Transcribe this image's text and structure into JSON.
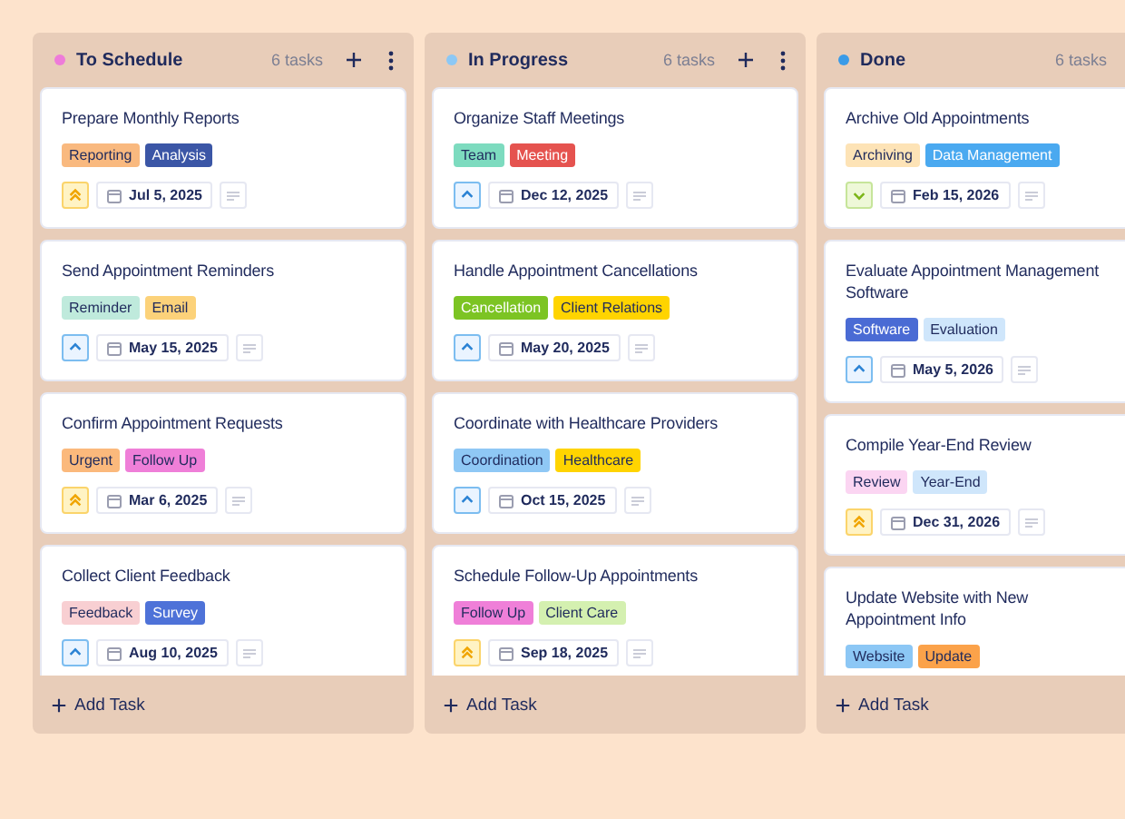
{
  "columns": [
    {
      "title": "To Schedule",
      "color": "#ee7bd9",
      "count": "6 tasks",
      "header_actions": true,
      "add_label": "Add Task",
      "cards": [
        {
          "title": "Prepare Monthly Reports",
          "tags": [
            {
              "label": "Reporting",
              "color": "#f9b97f"
            },
            {
              "label": "Analysis",
              "color": "#3b56a6"
            }
          ],
          "kind": "high",
          "date": "Jul 5, 2025"
        },
        {
          "title": "Send Appointment Reminders",
          "tags": [
            {
              "label": "Reminder",
              "color": "#bfeadc"
            },
            {
              "label": "Email",
              "color": "#fcd27a"
            }
          ],
          "kind": "medium",
          "date": "May 15, 2025"
        },
        {
          "title": "Confirm Appointment Requests",
          "tags": [
            {
              "label": "Urgent",
              "color": "#fbb97c"
            },
            {
              "label": "Follow Up",
              "color": "#ef7fd8"
            }
          ],
          "kind": "high",
          "date": "Mar 6, 2025"
        },
        {
          "title": "Collect Client Feedback",
          "tags": [
            {
              "label": "Feedback",
              "color": "#f8cfd2"
            },
            {
              "label": "Survey",
              "color": "#4e72d8"
            }
          ],
          "kind": "medium",
          "date": "Aug 10, 2025"
        }
      ]
    },
    {
      "title": "In Progress",
      "color": "#8cc8f5",
      "count": "6 tasks",
      "header_actions": true,
      "add_label": "Add Task",
      "cards": [
        {
          "title": "Organize Staff Meetings",
          "tags": [
            {
              "label": "Team",
              "color": "#7ddbbf"
            },
            {
              "label": "Meeting",
              "color": "#e5534f"
            }
          ],
          "kind": "medium",
          "date": "Dec 12, 2025"
        },
        {
          "title": "Handle Appointment Cancellations",
          "tags": [
            {
              "label": "Cancellation",
              "color": "#7cc423"
            },
            {
              "label": "Client Relations",
              "color": "#ffd400"
            }
          ],
          "kind": "medium",
          "date": "May 20, 2025"
        },
        {
          "title": "Coordinate with Healthcare Providers",
          "tags": [
            {
              "label": "Coordination",
              "color": "#8fc8f5"
            },
            {
              "label": "Healthcare",
              "color": "#ffd400"
            }
          ],
          "kind": "medium",
          "date": "Oct 15, 2025"
        },
        {
          "title": "Schedule Follow-Up Appointments",
          "tags": [
            {
              "label": "Follow Up",
              "color": "#ef7fd8"
            },
            {
              "label": "Client Care",
              "color": "#d4f0b0"
            }
          ],
          "kind": "high",
          "date": "Sep 18, 2025"
        }
      ]
    },
    {
      "title": "Done",
      "color": "#3a9be8",
      "count": "6 tasks",
      "header_actions": false,
      "add_label": "Add Task",
      "cards": [
        {
          "title": "Archive Old Appointments",
          "tags": [
            {
              "label": "Archiving",
              "color": "#fde3b6"
            },
            {
              "label": "Data Management",
              "color": "#4aa9f0"
            }
          ],
          "kind": "low",
          "date": "Feb 15, 2026"
        },
        {
          "title": "Evaluate Appointment Management Software",
          "tags": [
            {
              "label": "Software",
              "color": "#4a6bd4"
            },
            {
              "label": "Evaluation",
              "color": "#cfe6fb"
            }
          ],
          "kind": "medium",
          "date": "May 5, 2026"
        },
        {
          "title": "Compile Year-End Review",
          "tags": [
            {
              "label": "Review",
              "color": "#fbd5f2"
            },
            {
              "label": "Year-End",
              "color": "#cfe6fb"
            }
          ],
          "kind": "high",
          "date": "Dec 31, 2026"
        },
        {
          "title": "Update Website with New Appointment Info",
          "tags": [
            {
              "label": "Website",
              "color": "#8cc7f5"
            },
            {
              "label": "Update",
              "color": "#fba24a"
            }
          ]
        }
      ]
    }
  ]
}
